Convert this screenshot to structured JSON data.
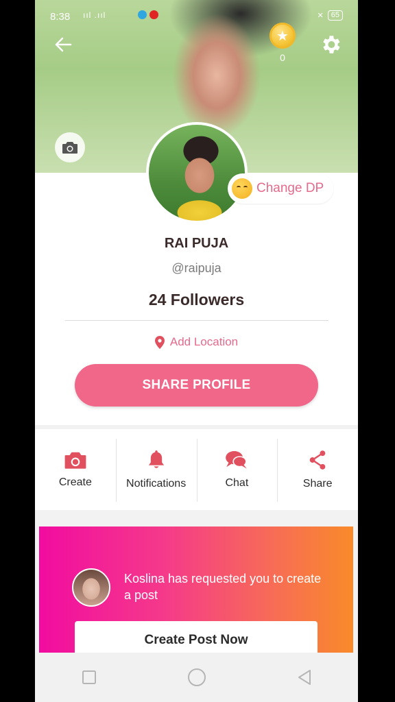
{
  "status_bar": {
    "time": "8:38",
    "signal": "ııl .ııl",
    "battery": "65"
  },
  "header": {
    "coin_count": "0"
  },
  "profile": {
    "change_dp_label": "Change DP",
    "name": "RAI PUJA",
    "handle": "@raipuja",
    "followers": "24 Followers",
    "location_label": "Add Location",
    "share_button": "SHARE PROFILE"
  },
  "actions": [
    {
      "label": "Create",
      "icon": "camera-icon"
    },
    {
      "label": "Notifications",
      "icon": "bell-icon"
    },
    {
      "label": "Chat",
      "icon": "chat-icon"
    },
    {
      "label": "Share",
      "icon": "share-icon"
    }
  ],
  "promo": {
    "message": "Koslina has requested you to create a post",
    "button": "Create Post Now"
  },
  "colors": {
    "accent": "#f0678a",
    "icon": "#e0505f",
    "promo_start": "#f10ca0",
    "promo_end": "#f98a2a"
  }
}
